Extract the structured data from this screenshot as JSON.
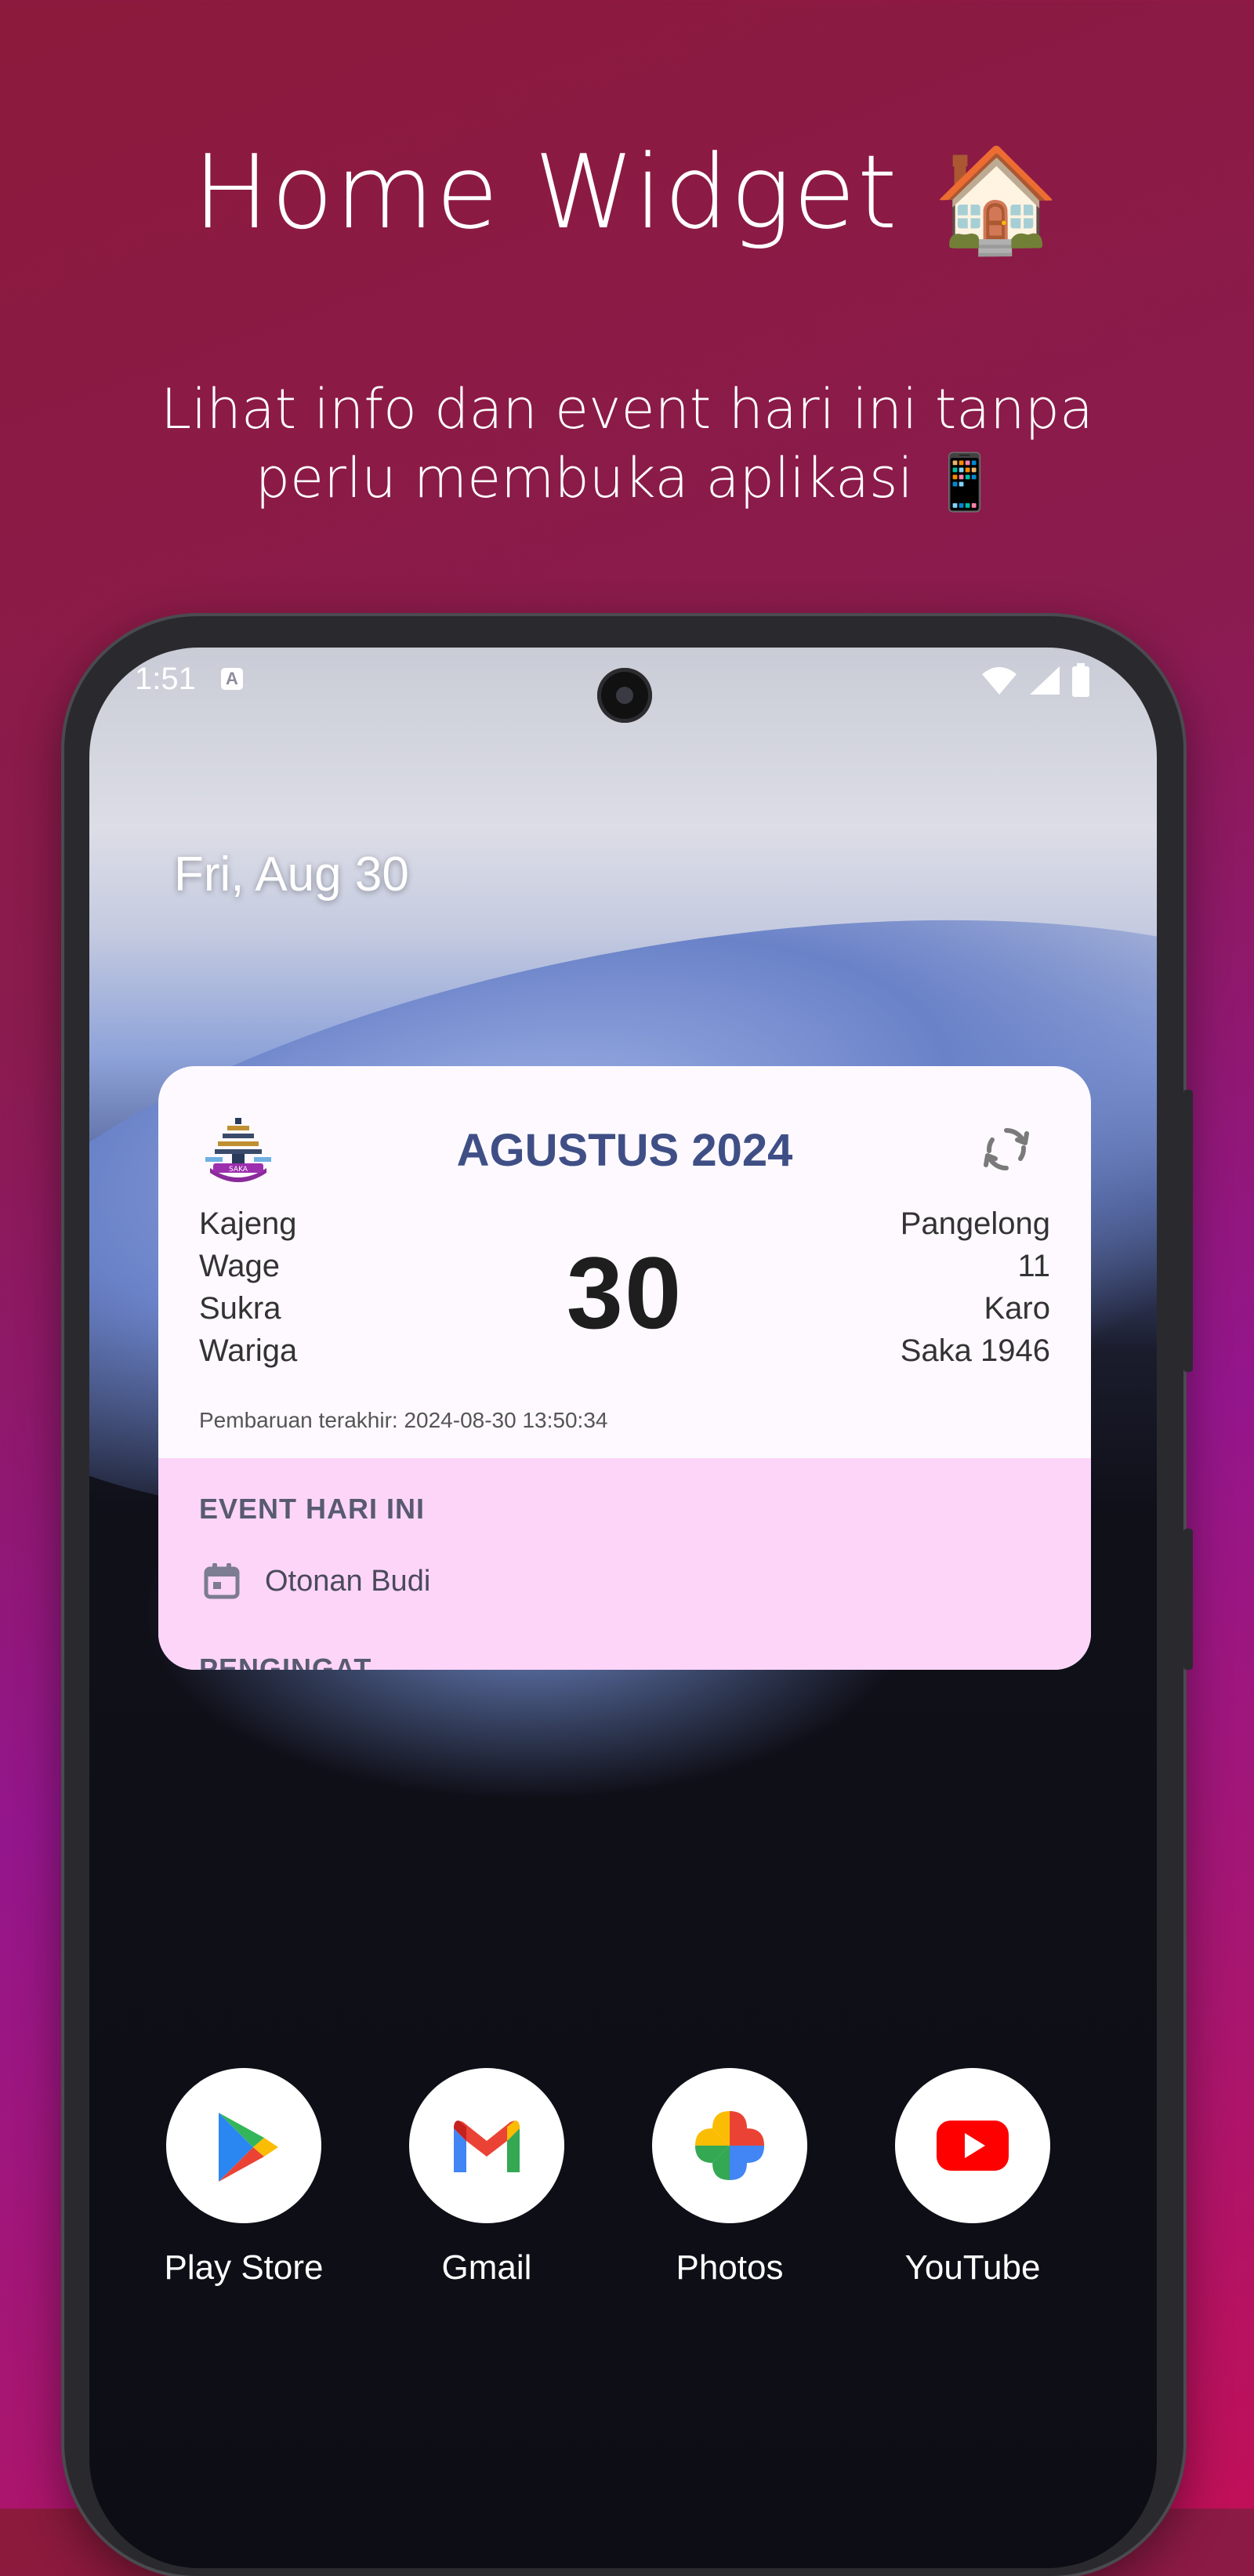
{
  "promo": {
    "title": "Home Widget",
    "title_emoji": "🏠",
    "subtitle_line1": "Lihat info dan event hari ini tanpa",
    "subtitle_line2": "perlu membuka aplikasi",
    "subtitle_emoji": "📱"
  },
  "status_bar": {
    "time": "1:51",
    "notification_letter": "A"
  },
  "home": {
    "date": "Fri, Aug 30"
  },
  "widget": {
    "logo_text": "SAKA",
    "month_title": "AGUSTUS 2024",
    "left_items": [
      "Kajeng",
      "Wage",
      "Sukra",
      "Wariga"
    ],
    "day": "30",
    "right_items": [
      "Pangelong",
      "11",
      "Karo",
      "Saka 1946"
    ],
    "last_updated": "Pembaruan terakhir: 2024-08-30 13:50:34",
    "events_title": "EVENT HARI INI",
    "event_name": "Otonan Budi",
    "reminders_title": "PENGINGAT"
  },
  "dock": {
    "apps": [
      {
        "label": "Play Store",
        "icon": "play-store-icon"
      },
      {
        "label": "Gmail",
        "icon": "gmail-icon"
      },
      {
        "label": "Photos",
        "icon": "photos-icon"
      },
      {
        "label": "YouTube",
        "icon": "youtube-icon"
      }
    ]
  },
  "colors": {
    "widget_title": "#3f4f86",
    "events_background": "#fdd5f9",
    "widget_background": "#fdf9ff"
  }
}
